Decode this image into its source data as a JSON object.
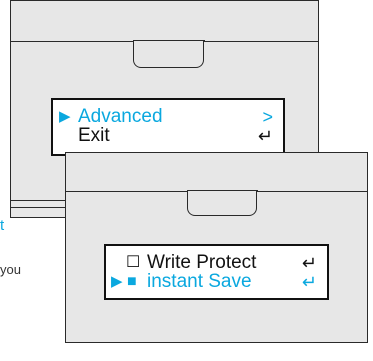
{
  "background_fragments": {
    "link_fragment": "t",
    "text_fragment": "you"
  },
  "back_menu": {
    "items": [
      {
        "selector": "▶",
        "label": "Advanced",
        "end_icon": ">"
      },
      {
        "selector": "",
        "label": "Exit",
        "end_icon": "↵"
      }
    ]
  },
  "front_menu": {
    "items": [
      {
        "selector": "",
        "checkbox": "☐",
        "label": "Write Protect",
        "end_icon": "↵"
      },
      {
        "selector": "▶",
        "checkbox": "■",
        "label": "instant Save",
        "end_icon": "↵"
      }
    ]
  },
  "colors": {
    "highlight": "#0aa8df",
    "text": "#111111",
    "panel": "#e7e7e7"
  }
}
